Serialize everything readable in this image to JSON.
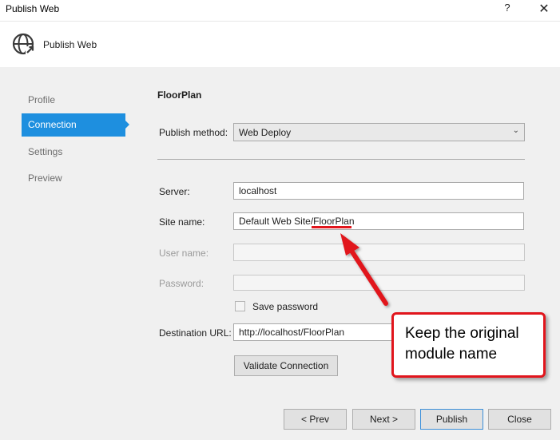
{
  "window": {
    "title": "Publish Web",
    "help_glyph": "?",
    "close_glyph": "✕"
  },
  "header": {
    "title": "Publish Web",
    "icon": "globe-publish-icon"
  },
  "nav": {
    "items": [
      {
        "label": "Profile",
        "active": false
      },
      {
        "label": "Connection",
        "active": true
      },
      {
        "label": "Settings",
        "active": false
      },
      {
        "label": "Preview",
        "active": false
      }
    ]
  },
  "section": {
    "title": "FloorPlan"
  },
  "form": {
    "publish_method_label": "Publish method:",
    "publish_method_value": "Web Deploy",
    "server_label": "Server:",
    "server_value": "localhost",
    "site_name_label": "Site name:",
    "site_name_value": "Default Web Site/FloorPlan",
    "user_name_label": "User name:",
    "user_name_value": "",
    "password_label": "Password:",
    "password_value": "",
    "save_password_label": "Save password",
    "save_password_checked": false,
    "destination_url_label": "Destination URL:",
    "destination_url_value": "http://localhost/FloorPlan",
    "validate_label": "Validate Connection"
  },
  "footer": {
    "prev_label": "< Prev",
    "next_label": "Next >",
    "publish_label": "Publish",
    "close_label": "Close"
  },
  "annotation": {
    "callout_line1": "Keep the original",
    "callout_line2": "module name",
    "accent_color": "#e1151c"
  },
  "colors": {
    "nav_active": "#1e8fdf",
    "content_bg": "#f0f0f0"
  }
}
